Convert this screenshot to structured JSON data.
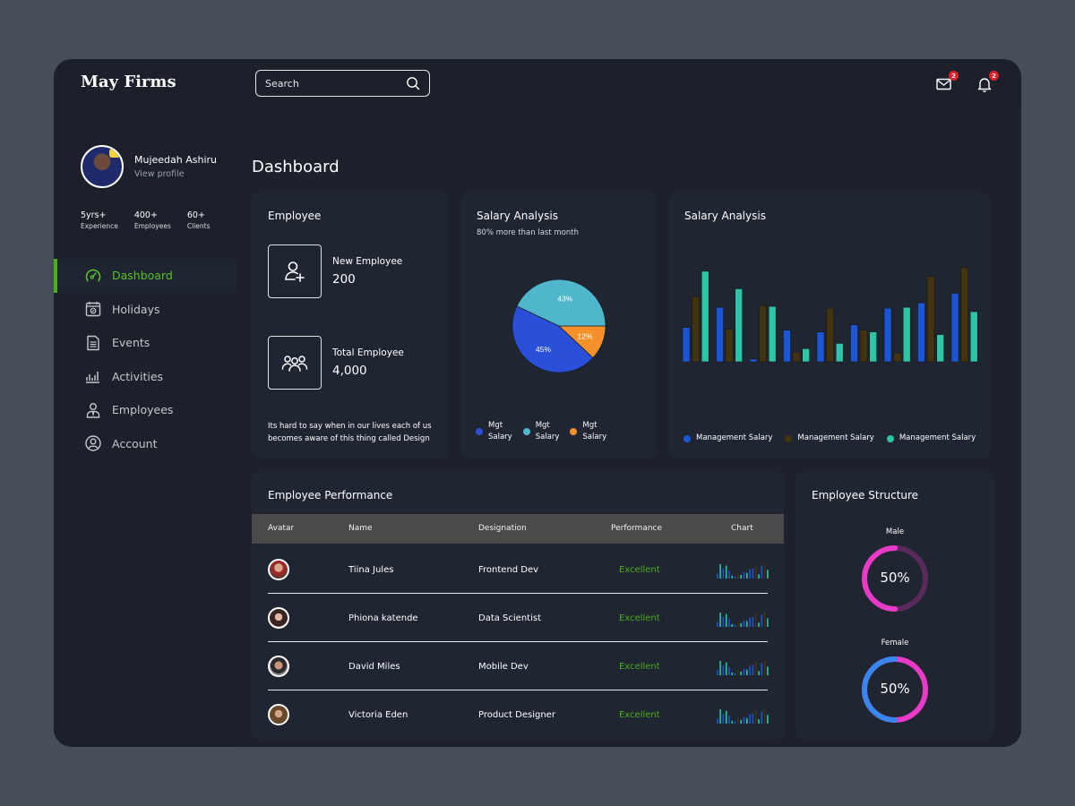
{
  "app": {
    "brand": "May Firms"
  },
  "search": {
    "placeholder": "Search",
    "value": ""
  },
  "notifications": {
    "mail_count": "2",
    "bell_count": "2"
  },
  "profile": {
    "name": "Mujeedah Ashiru",
    "link": "View profile",
    "stats": [
      {
        "value": "5yrs+",
        "label": "Experience"
      },
      {
        "value": "400+",
        "label": "Employees"
      },
      {
        "value": "60+",
        "label": "Clients"
      }
    ]
  },
  "nav": [
    {
      "label": "Dashboard",
      "icon": "speedometer-icon",
      "active": true
    },
    {
      "label": "Holidays",
      "icon": "calendar-icon",
      "active": false
    },
    {
      "label": "Events",
      "icon": "document-icon",
      "active": false
    },
    {
      "label": "Activities",
      "icon": "bar-chart-icon",
      "active": false
    },
    {
      "label": "Employees",
      "icon": "user-tie-icon",
      "active": false
    },
    {
      "label": "Account",
      "icon": "account-circle-icon",
      "active": false
    }
  ],
  "page": {
    "title": "Dashboard"
  },
  "employee_card": {
    "title": "Employee",
    "new_label": "New Employee",
    "new_value": "200",
    "total_label": "Total Employee",
    "total_value": "4,000",
    "note": "Its hard to say when in our lives each of us becomes aware of this thing called Design"
  },
  "colors": {
    "accent_green": "#4caf1e",
    "pie_blue": "#2a4fd8",
    "pie_teal": "#4fb6cc",
    "pie_orange": "#f5912a",
    "bar_blue": "#1a56d6",
    "bar_brown": "#44330f",
    "bar_teal": "#2ec4a6",
    "ring_pink": "#e93bc7",
    "ring_purple": "#5a2a5c",
    "ring_blue": "#3a86f0"
  },
  "chart_data": [
    {
      "type": "pie",
      "title": "Salary Analysis",
      "subtitle": "80% more than last month",
      "slices": [
        {
          "label": "Mgt Salary",
          "value": 45,
          "display": "45%",
          "color": "#2a4fd8"
        },
        {
          "label": "Mgt Salary",
          "value": 43,
          "display": "43%",
          "color": "#4fb6cc"
        },
        {
          "label": "Mgt Salary",
          "value": 12,
          "display": "12%",
          "color": "#f5912a"
        }
      ],
      "legend": [
        {
          "line1": "Mgt",
          "line2": "Salary",
          "color": "#2a4fd8"
        },
        {
          "line1": "Mgt",
          "line2": "Salary",
          "color": "#4fb6cc"
        },
        {
          "line1": "Mgt",
          "line2": "Salary",
          "color": "#f5912a"
        }
      ],
      "legend_position": "bottom"
    },
    {
      "type": "bar",
      "title": "Salary Analysis",
      "categories": [
        "1",
        "2",
        "3",
        "4",
        "5",
        "6",
        "7",
        "8",
        "9"
      ],
      "series": [
        {
          "name": "Management Salary",
          "color": "#1a56d6",
          "values": [
            39,
            62,
            3,
            36,
            34,
            42,
            61,
            67,
            78
          ]
        },
        {
          "name": "Management Salary",
          "color": "#44330f",
          "values": [
            74,
            37,
            64,
            11,
            61,
            36,
            10,
            97,
            107
          ]
        },
        {
          "name": "Management Salary",
          "color": "#2ec4a6",
          "values": [
            103,
            83,
            63,
            15,
            21,
            34,
            62,
            31,
            57
          ]
        }
      ],
      "ylim": [
        0,
        110
      ],
      "grid": false,
      "axes_visible": false,
      "legend_position": "bottom"
    }
  ],
  "performance": {
    "title": "Employee Performance",
    "columns": [
      "Avatar",
      "Name",
      "Designation",
      "Performance",
      "Chart"
    ],
    "rows": [
      {
        "name": "Tiina Jules",
        "designation": "Frontend Dev",
        "performance": "Excellent"
      },
      {
        "name": "Phiona katende",
        "designation": "Data Scientist",
        "performance": "Excellent"
      },
      {
        "name": "David Miles",
        "designation": "Mobile Dev",
        "performance": "Excellent"
      },
      {
        "name": "Victoria Eden",
        "designation": "Product Designer",
        "performance": "Excellent"
      }
    ],
    "sparkline": [
      {
        "v": 0.35,
        "c": "#1a56d6"
      },
      {
        "v": 1.0,
        "c": "#2ec4a6"
      },
      {
        "v": 0.7,
        "c": "#1a56d6"
      },
      {
        "v": 0.9,
        "c": "#2ec4a6"
      },
      {
        "v": 0.55,
        "c": "#1a56d6"
      },
      {
        "v": 0.2,
        "c": "#2ec4a6"
      },
      {
        "v": 0.15,
        "c": "#1a56d6"
      },
      {
        "v": 0.35,
        "c": "#44330f"
      },
      {
        "v": 0.25,
        "c": "#2ec4a6"
      },
      {
        "v": 0.45,
        "c": "#1a56d6"
      },
      {
        "v": 0.4,
        "c": "#2ec4a6"
      },
      {
        "v": 0.65,
        "c": "#1a56d6"
      },
      {
        "v": 0.7,
        "c": "#1a56d6"
      },
      {
        "v": 0.95,
        "c": "#44330f"
      },
      {
        "v": 0.3,
        "c": "#2ec4a6"
      },
      {
        "v": 0.85,
        "c": "#1a56d6"
      },
      {
        "v": 1.0,
        "c": "#44330f"
      },
      {
        "v": 0.6,
        "c": "#2ec4a6"
      }
    ]
  },
  "structure": {
    "title": "Employee Structure",
    "male": {
      "label": "Male",
      "value": 50,
      "display": "50%"
    },
    "female": {
      "label": "Female",
      "value": 50,
      "display": "50%"
    }
  }
}
